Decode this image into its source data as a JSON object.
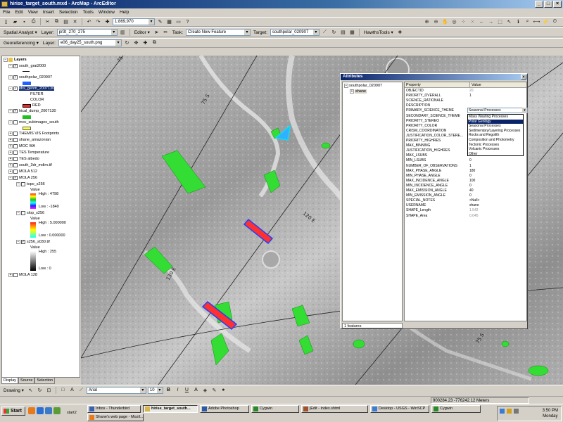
{
  "window": {
    "title": "hirise_target_south.mxd - ArcMap - ArcEditor",
    "buttons": [
      "_",
      "□",
      "×"
    ]
  },
  "menubar": [
    "File",
    "Edit",
    "View",
    "Insert",
    "Selection",
    "Tools",
    "Window",
    "Help"
  ],
  "toolbar1": {
    "scale": "1:869,970"
  },
  "toolbar2": {
    "spatial_analyst_label": "Spatial Analyst ▾",
    "layer_label": "Layer:",
    "layer_value": "pr3t_270_275",
    "editor_label": "Editor ▾",
    "task_label": "Task:",
    "task_value": "Create New Feature",
    "target_label": "Target:",
    "target_value": "southpolar_020907",
    "hawths_label": "HawthsTools ▾"
  },
  "toolbar3": {
    "georef_label": "Georeferencing ▾",
    "layer_label": "Layer:",
    "layer_value": "e06_day25_south.png"
  },
  "toc": {
    "root": "Layers",
    "layers": [
      {
        "name": "south_grat2000",
        "checked": true
      },
      {
        "name": "southpolar_020907",
        "checked": true,
        "swatch": "#2060ff"
      },
      {
        "name": "obs_geom_2007130",
        "checked": true,
        "selected": true
      },
      {
        "name": "FILTER"
      },
      {
        "name": "COLOR"
      },
      {
        "name": "RED",
        "swatch": "#ff2020"
      },
      {
        "name": "hical_dump_2007130",
        "checked": true,
        "swatch": "#20c020"
      },
      {
        "name": "moc_subimages_south",
        "checked": false,
        "swatch": "#ffff40"
      },
      {
        "name": "THEMIS VIS Footprints",
        "checked": false
      },
      {
        "name": "shane_amazonian",
        "checked": false
      },
      {
        "name": "MOC WA",
        "checked": false
      },
      {
        "name": "TES Temperature",
        "checked": false
      },
      {
        "name": "TES albedo",
        "checked": false
      },
      {
        "name": "south_3dr_mdim.tif",
        "checked": false
      },
      {
        "name": "MOLA 512",
        "checked": false
      },
      {
        "name": "MOLA 256",
        "checked": true
      },
      {
        "name": "topo_s256",
        "checked": false
      },
      {
        "name": "Value"
      },
      {
        "name": "High : 4798"
      },
      {
        "name": "Low : -1840"
      },
      {
        "name": "slop_s256",
        "checked": false
      },
      {
        "name": "Value"
      },
      {
        "name": "High : 5.000000"
      },
      {
        "name": "Low : 0.000000"
      },
      {
        "name": "s256_s030.tif",
        "checked": true
      },
      {
        "name": "Value"
      },
      {
        "name": "High : 255"
      },
      {
        "name": "Low : 0"
      },
      {
        "name": "MOLA 128",
        "checked": false
      }
    ],
    "tabs": [
      "Display",
      "Source",
      "Selection"
    ]
  },
  "map": {
    "labels": [
      "75 S",
      "75 S",
      "120 E",
      "130 E",
      "75 S"
    ]
  },
  "attributes": {
    "title": "Attributes",
    "tree_root": "southpolar_020907",
    "tree_child": "shane",
    "header_property": "Property",
    "header_value": "Value",
    "rows": [
      [
        "OBJECTID",
        "20"
      ],
      [
        "PRIORITY_OVERALL",
        "1"
      ],
      [
        "SCIENCE_RATIONALE",
        ""
      ],
      [
        "DESCRIPTION",
        ""
      ],
      [
        "PRIMARY_SCIENCE_THEME",
        ""
      ],
      [
        "SECONDARY_SCIENCE_THEME",
        ""
      ],
      [
        "PRIORITY_STEREO",
        ""
      ],
      [
        "PRIORITY_COLOR",
        ""
      ],
      [
        "CRISM_COORDINATION",
        ""
      ],
      [
        "JUSTIFICATION_COLOR_STERE...",
        ""
      ],
      [
        "PRIORITY_HIGHRES",
        ""
      ],
      [
        "MAX_BINNING",
        ""
      ],
      [
        "JUSTIFICATION_HIGHRES",
        ""
      ],
      [
        "MAX_LSUBS",
        ""
      ],
      [
        "MIN_LSUBS",
        "0"
      ],
      [
        "NUMBER_OF_OBSERVATIONS",
        "1"
      ],
      [
        "MAX_PHASE_ANGLE",
        "180"
      ],
      [
        "MIN_PHASE_ANGLE",
        "0"
      ],
      [
        "MAX_INCIDENCE_ANGLE",
        "100"
      ],
      [
        "MIN_INCIDENCE_ANGLE",
        "0"
      ],
      [
        "MAX_EMISSION_ANGLE",
        "40"
      ],
      [
        "MIN_EMISSION_ANGLE",
        "0"
      ],
      [
        "SPECIAL_NOTES",
        "<Null>"
      ],
      [
        "USERNAME",
        "shane"
      ],
      [
        "SHAPE_Length",
        "1.542"
      ],
      [
        "SHAPE_Area",
        "0.045"
      ]
    ],
    "dropdown_value": "Seasonal Processes",
    "dropdown_options": [
      "Mass Wasting Processes",
      "Polar Geology",
      "Seasonal Processes",
      "Sedimentary/Layering Processes",
      "Rocks and Regolith",
      "Composition and Photometry",
      "Tectonic Processes",
      "Volcanic Processes",
      "Other"
    ],
    "dropdown_selected": "Polar Geology",
    "footer": "1 features"
  },
  "drawing_bar": {
    "drawing_label": "Drawing ▾",
    "font": "Arial",
    "size": "10",
    "bold": "B",
    "italic": "I",
    "underline": "U"
  },
  "status": {
    "coords": "900284.23  -776242.12 Meters"
  },
  "taskbar": {
    "start": "Start",
    "group": "start2",
    "tasks": [
      {
        "label": "Inbox - Thunderbird",
        "active": false
      },
      {
        "label": "hirise_target_south...",
        "active": true
      },
      {
        "label": "Adobe Photoshop",
        "active": false
      },
      {
        "label": "Cygwin",
        "active": false
      },
      {
        "label": "jEdit - index.shtml",
        "active": false
      },
      {
        "label": "Desktop - USGS - WinSCP",
        "active": false
      },
      {
        "label": "Cygwin",
        "active": false
      },
      {
        "label": "Shane's web page - Mozil...",
        "active": false
      }
    ],
    "time": "3:50 PM",
    "day": "Monday"
  }
}
